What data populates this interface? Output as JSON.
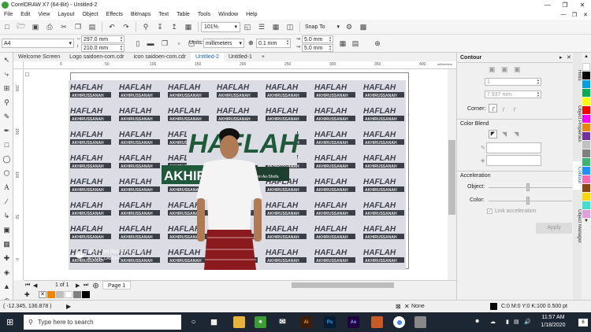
{
  "app": {
    "title": "CorelDRAW X7 (64-Bit) - Untitled-2"
  },
  "menu": [
    "File",
    "Edit",
    "View",
    "Layout",
    "Object",
    "Effects",
    "Bitmaps",
    "Text",
    "Table",
    "Tools",
    "Window",
    "Help"
  ],
  "std_toolbar": {
    "zoom": "101%",
    "snap_to": "Snap To"
  },
  "propbar": {
    "page_size": "A4",
    "width": "297.0 mm",
    "height": "210.0 mm",
    "units_label": "Units:",
    "units": "millimeters",
    "nudge": "0.1 mm",
    "dup_x": "5.0 mm",
    "dup_y": "5.0 mm"
  },
  "doc_tabs": [
    "Welcome Screen",
    "Logo saidoen-com.cdr",
    "icon saidoen-com.cdr",
    "Untitled-2",
    "Untitled-1"
  ],
  "active_tab": "Untitled-2",
  "ruler": {
    "h_ticks": [
      "0",
      "50",
      "100",
      "150",
      "200",
      "250",
      "300",
      "350",
      "400"
    ],
    "v_ticks": [
      "200",
      "150",
      "100",
      "50",
      "0"
    ],
    "units": "millimeters"
  },
  "photo": {
    "banner_word": "HAFLAH",
    "banner_sub": "AKHIRUSSANAH",
    "center_word": "HAFLAH",
    "center_sub": "AKHIRU",
    "pondok": "Pondok Pesantren As-Shofa",
    "watermark_line1": "SHOT ON REDMI NOTE 8",
    "watermark_line2": "AI DUAL CAMERA"
  },
  "pagebar": {
    "page_count": "1 of 1",
    "page_tab": "Page 1"
  },
  "docker": {
    "title": "Contour",
    "steps_value": "1",
    "offset_value": "7.937 mm",
    "corner_label": "Corner:",
    "color_blend_label": "Color Blend",
    "acceleration_label": "Acceleration",
    "object_label": "Object:",
    "color_label": "Color:",
    "link_accel_label": "Link acceleration",
    "apply_label": "Apply"
  },
  "side_tabs": [
    "Hints",
    "Object Properties",
    "Contour",
    "Object Manager"
  ],
  "status": {
    "coords": "( -12.345, 136.878 )",
    "fill_label": "None",
    "outline_info": "C:0 M:0 Y:0 K:100  0.500 pt"
  },
  "taskbar": {
    "search_placeholder": "Type here to search",
    "time": "11:57 AM",
    "date": "1/18/2020",
    "notification_count": "6"
  },
  "colors": {
    "accent_blue": "#1a5fb4",
    "banner_green": "#1e5a3a",
    "taskbar": "#1d2733",
    "palette": [
      "#ffffff",
      "#000000",
      "#00a0e9",
      "#00b050",
      "#ffff00",
      "#ff0000",
      "#ff00ff",
      "#f08300",
      "#7030a0",
      "#c0c0c0",
      "#808080",
      "#3cb371",
      "#1e90ff",
      "#ff69b4",
      "#8b4513"
    ]
  }
}
